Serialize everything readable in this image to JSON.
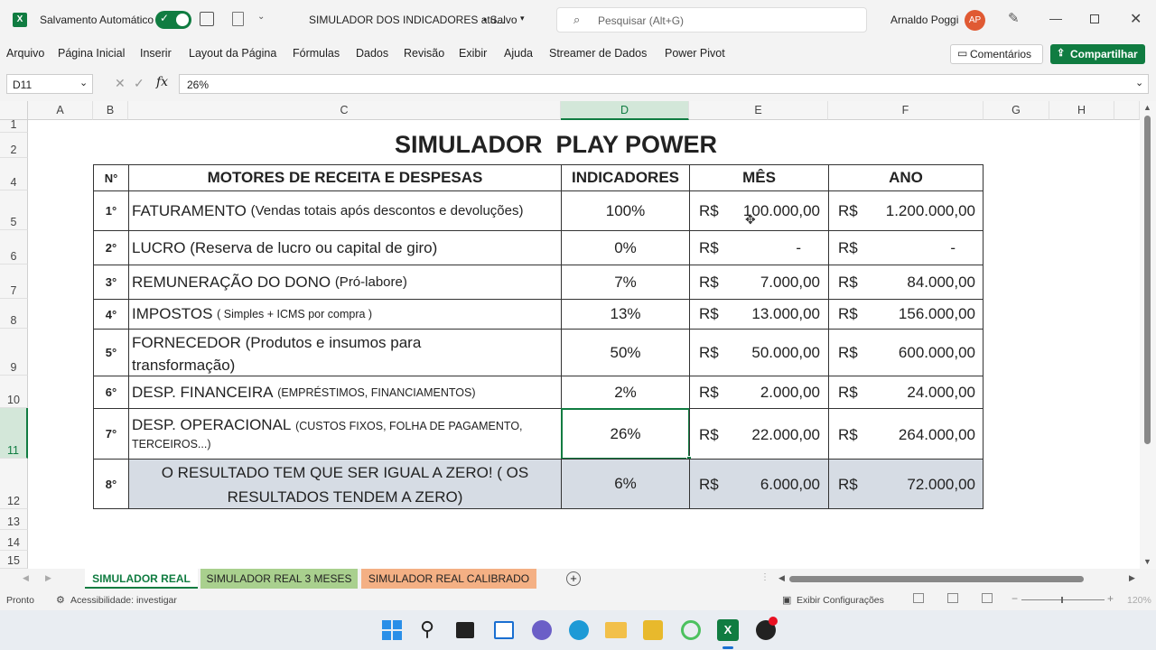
{
  "titlebar": {
    "autosave_label": "Salvamento Automático",
    "doc_title": "SIMULADOR DOS INDICADORES atu...",
    "saved_status": "• Salvo",
    "search_placeholder": "Pesquisar (Alt+G)",
    "user_name": "Arnaldo Poggi",
    "user_initials": "AP"
  },
  "menu": {
    "items": [
      "Arquivo",
      "Página Inicial",
      "Inserir",
      "Layout da Página",
      "Fórmulas",
      "Dados",
      "Revisão",
      "Exibir",
      "Ajuda",
      "Streamer de Dados",
      "Power Pivot"
    ],
    "comments_label": "Comentários",
    "share_label": "Compartilhar"
  },
  "formula_bar": {
    "name_box": "D11",
    "fx": "fx",
    "value": "26%"
  },
  "columns": [
    "A",
    "B",
    "C",
    "D",
    "E",
    "F",
    "G",
    "H"
  ],
  "rows": [
    "1",
    "2",
    "4",
    "5",
    "6",
    "7",
    "8",
    "9",
    "10",
    "11",
    "12",
    "13",
    "14",
    "15"
  ],
  "sheet": {
    "title": "SIMULADOR  PLAY POWER",
    "headers": {
      "n": "N°",
      "motores": "MOTORES DE RECEITA E DESPESAS",
      "indicadores": "INDICADORES",
      "mes": "MÊS",
      "ano": "ANO"
    },
    "currency": "R$",
    "rows": [
      {
        "n": "1°",
        "label": "FATURAMENTO",
        "note": "(Vendas totais após descontos e devoluções)",
        "pct": "100%",
        "mes": "100.000,00",
        "ano": "1.200.000,00"
      },
      {
        "n": "2°",
        "label": "LUCRO (Reserva de lucro ou capital de giro)",
        "note": "",
        "pct": "0%",
        "mes": "-",
        "ano": "-"
      },
      {
        "n": "3°",
        "label": "REMUNERAÇÃO DO DONO",
        "note": "(Pró-labore)",
        "pct": "7%",
        "mes": "7.000,00",
        "ano": "84.000,00"
      },
      {
        "n": "4°",
        "label": "IMPOSTOS",
        "note": "( Simples + ICMS por compra )",
        "pct": "13%",
        "mes": "13.000,00",
        "ano": "156.000,00"
      },
      {
        "n": "5°",
        "label": "FORNECEDOR (Produtos e insumos para",
        "label2": "transformação)",
        "note": "",
        "pct": "50%",
        "mes": "50.000,00",
        "ano": "600.000,00"
      },
      {
        "n": "6°",
        "label": "DESP. FINANCEIRA",
        "note": "(EMPRÉSTIMOS, FINANCIAMENTOS)",
        "pct": "2%",
        "mes": "2.000,00",
        "ano": "24.000,00"
      },
      {
        "n": "7°",
        "label": "DESP. OPERACIONAL",
        "note": "(CUSTOS FIXOS, FOLHA DE PAGAMENTO,",
        "note2": "TERCEIROS...)",
        "pct": "26%",
        "mes": "22.000,00",
        "ano": "264.000,00"
      },
      {
        "n": "8°",
        "label": "O RESULTADO TEM QUE SER IGUAL A ZERO! ( OS",
        "label2": "RESULTADOS TENDEM A ZERO)",
        "note": "",
        "pct": "6%",
        "mes": "6.000,00",
        "ano": "72.000,00"
      }
    ]
  },
  "tabs": [
    {
      "label": "SIMULADOR REAL",
      "color": "#ffffff"
    },
    {
      "label": "SIMULADOR REAL 3 MESES",
      "color": "#a9d08e"
    },
    {
      "label": "SIMULADOR REAL CALIBRADO",
      "color": "#f4b084"
    }
  ],
  "status": {
    "ready": "Pronto",
    "accessibility": "Acessibilidade: investigar",
    "display_settings": "Exibir Configurações",
    "zoom": "120%"
  },
  "colors": {
    "excel_green": "#107c41",
    "gray_fill": "#d6dce4",
    "avatar": "#e05a33"
  }
}
